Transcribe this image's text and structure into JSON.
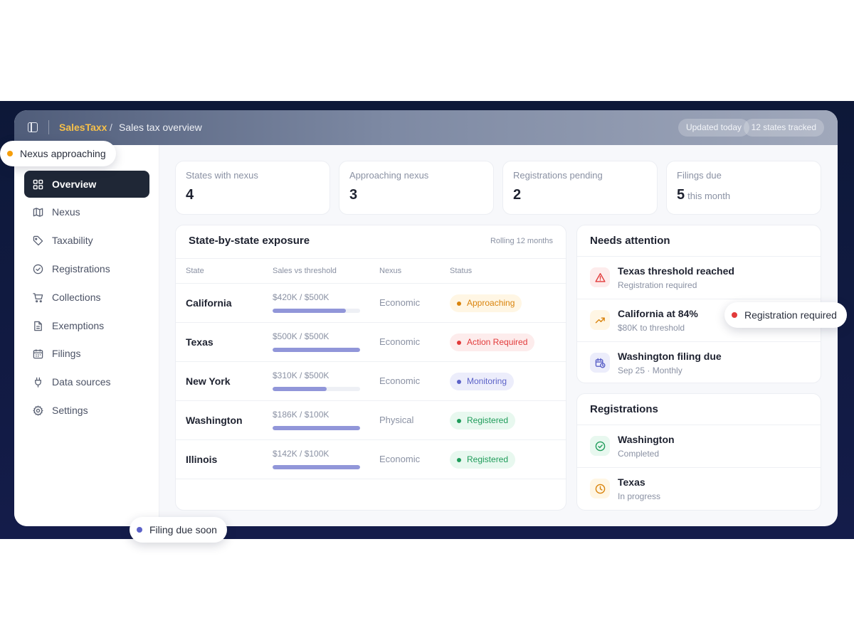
{
  "header": {
    "brand": "SalesTaxx",
    "separator": "/",
    "page": "Sales tax overview",
    "pills": [
      "Updated today",
      "12 states tracked"
    ]
  },
  "sidebar": {
    "items": [
      {
        "label": "Overview",
        "icon": "grid-icon",
        "active": true
      },
      {
        "label": "Nexus",
        "icon": "map-icon",
        "active": false
      },
      {
        "label": "Taxability",
        "icon": "tag-icon",
        "active": false
      },
      {
        "label": "Registrations",
        "icon": "check-circle-icon",
        "active": false
      },
      {
        "label": "Collections",
        "icon": "cart-icon",
        "active": false
      },
      {
        "label": "Exemptions",
        "icon": "document-icon",
        "active": false
      },
      {
        "label": "Filings",
        "icon": "calendar-icon",
        "active": false
      },
      {
        "label": "Data sources",
        "icon": "plug-icon",
        "active": false
      },
      {
        "label": "Settings",
        "icon": "gear-icon",
        "active": false
      }
    ]
  },
  "stats": [
    {
      "label": "States with nexus",
      "value": "4",
      "sub": ""
    },
    {
      "label": "Approaching nexus",
      "value": "3",
      "sub": ""
    },
    {
      "label": "Registrations pending",
      "value": "2",
      "sub": ""
    },
    {
      "label": "Filings due",
      "value": "5",
      "sub": "this month"
    }
  ],
  "exposure": {
    "title": "State-by-state exposure",
    "note": "Rolling 12 months",
    "columns": [
      "State",
      "Sales vs threshold",
      "Nexus",
      "Status"
    ],
    "rows": [
      {
        "state": "California",
        "sales": "$420K / $500K",
        "progress": 0.84,
        "nexus": "Economic",
        "status": "Approaching",
        "tone": "amber"
      },
      {
        "state": "Texas",
        "sales": "$500K / $500K",
        "progress": 1.0,
        "nexus": "Economic",
        "status": "Action Required",
        "tone": "red"
      },
      {
        "state": "New York",
        "sales": "$310K / $500K",
        "progress": 0.62,
        "nexus": "Economic",
        "status": "Monitoring",
        "tone": "blue"
      },
      {
        "state": "Washington",
        "sales": "$186K / $100K",
        "progress": 1.0,
        "nexus": "Physical",
        "status": "Registered",
        "tone": "green"
      },
      {
        "state": "Illinois",
        "sales": "$142K / $100K",
        "progress": 1.0,
        "nexus": "Economic",
        "status": "Registered",
        "tone": "green"
      }
    ]
  },
  "attention": {
    "title": "Needs attention",
    "items": [
      {
        "title": "Texas threshold reached",
        "sub": "Registration required",
        "icon": "alert-triangle-icon",
        "tone": "red"
      },
      {
        "title": "California at 84%",
        "sub": "$80K to threshold",
        "icon": "trending-up-icon",
        "tone": "amber"
      },
      {
        "title": "Washington filing due",
        "sub": "Sep 25 · Monthly",
        "icon": "calendar-clock-icon",
        "tone": "blue"
      }
    ]
  },
  "registrations": {
    "title": "Registrations",
    "items": [
      {
        "title": "Washington",
        "sub": "Completed",
        "icon": "check-circle-icon",
        "tone": "green"
      },
      {
        "title": "Texas",
        "sub": "In progress",
        "icon": "clock-icon",
        "tone": "amber"
      }
    ]
  },
  "floats": [
    {
      "label": "Nexus approaching",
      "color": "#f59e0b"
    },
    {
      "label": "Registration required",
      "color": "#e23a3a"
    },
    {
      "label": "Filing due soon",
      "color": "#5c62c8"
    }
  ],
  "colors": {
    "brand": "#f6c04a",
    "amber": "#d9830c",
    "red": "#e23a3a",
    "blue": "#5c62c8",
    "green": "#1f9c5a",
    "bar": "#9196d9"
  }
}
